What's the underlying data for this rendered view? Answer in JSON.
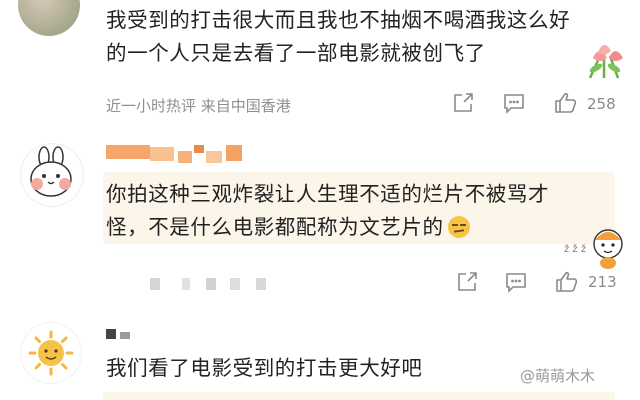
{
  "comments": [
    {
      "text_lines": [
        "我受到的打击很大而且我也不抽烟不喝酒我这么好",
        "的一个人只是去看了一部电影就被创飞了"
      ],
      "meta": "近一小时热评 来自中国香港",
      "like_count": "258",
      "sticker": "tulip-bouquet-sticker"
    },
    {
      "text_lines": [
        "你拍这种三观炸裂让人生理不适的烂片不被骂才",
        "怪，不是什么电影都配称为文艺片的"
      ],
      "emoji": "smirk-emoji",
      "like_count": "213",
      "username_obscured": true,
      "sticker": "cartoon-character-sticker"
    },
    {
      "text_lines": [
        "我们看了电影受到的打击更大好吧"
      ],
      "username_obscured": true
    }
  ],
  "watermark": "@萌萌木木",
  "colors": {
    "bubble": "#fbf5ea",
    "meta": "#8f8f8f",
    "text": "#222222"
  }
}
